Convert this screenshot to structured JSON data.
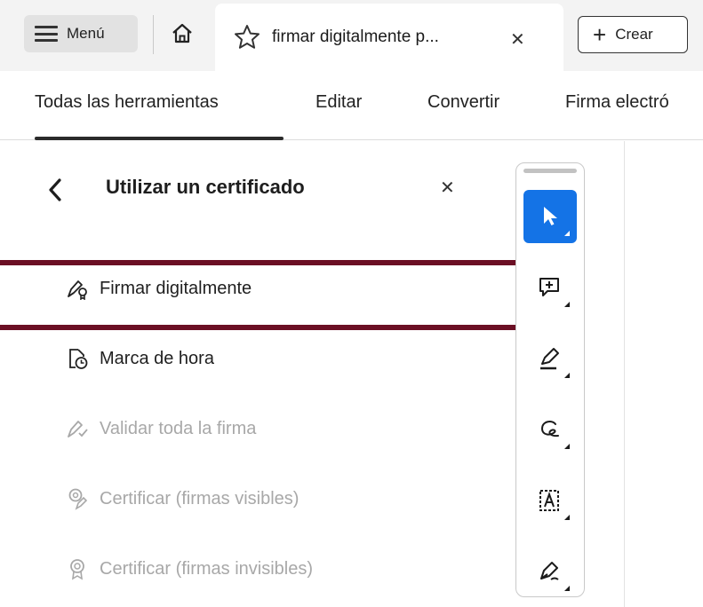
{
  "tabbar": {
    "menu_label": "Menú",
    "doc_tab_title": "firmar digitalmente p...",
    "close_glyph": "✕",
    "create_label": "Crear"
  },
  "nav": {
    "items": [
      "Todas las herramientas",
      "Editar",
      "Convertir",
      "Firma electró"
    ],
    "active": "Todas las herramientas"
  },
  "panel": {
    "title": "Utilizar un certificado",
    "items": [
      {
        "label": "Firmar digitalmente",
        "icon": "sign-digital-icon",
        "enabled": true,
        "highlighted": true
      },
      {
        "label": "Marca de hora",
        "icon": "timestamp-icon",
        "enabled": true
      },
      {
        "label": "Validar toda la firma",
        "icon": "validate-signature-icon",
        "enabled": false
      },
      {
        "label": "Certificar (firmas visibles)",
        "icon": "certify-visible-icon",
        "enabled": false
      },
      {
        "label": "Certificar (firmas invisibles)",
        "icon": "certify-invisible-icon",
        "enabled": false
      }
    ]
  },
  "toolbar": {
    "tools": [
      "select-cursor-icon",
      "add-comment-icon",
      "highlight-pen-icon",
      "draw-freeform-icon",
      "text-recognition-icon",
      "sign-pen-icon"
    ],
    "active_tool": "select-cursor-icon",
    "accent": "#1473e6"
  },
  "colors": {
    "highlight_border": "#6b0f24",
    "accent": "#1473e6"
  }
}
